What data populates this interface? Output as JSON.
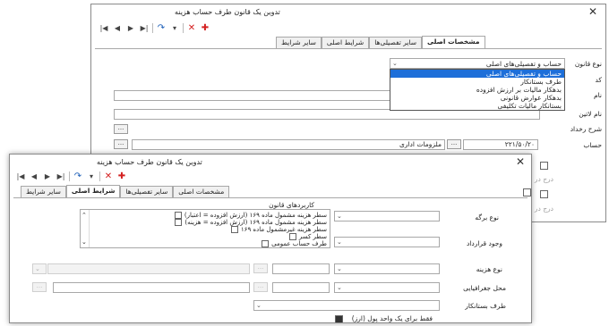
{
  "back_window": {
    "title": "تدوین یک قانون طرف حساب هزینه",
    "tabs": [
      "مشخصات اصلی",
      "سایر تفصیلی‌ها",
      "شرایط اصلی",
      "سایر شرایط"
    ],
    "labels": {
      "rule_type": "نوع قانون",
      "code_prefix": "کد",
      "name": "نام",
      "latin_name": "نام لاتین",
      "description": "شرح رخداد",
      "account": "حساب",
      "level_1": "درج در",
      "level_2": "درج در"
    },
    "rule_type_value": "حساب و تفصیلی‌های اصلی",
    "rule_type_options": [
      "حساب و تفصیلی‌های اصلی",
      "طرف بستانکار",
      "بدهکار مالیات بر ارزش افزوده",
      "بدهکار عوارض قانونی",
      "بستانکار مالیات تکلیفی"
    ],
    "account_code": "۲۲۱/۵۰/۲۰",
    "account_name": "ملزومات اداری"
  },
  "front_window": {
    "title": "تدوین یک قانون طرف حساب هزینه",
    "tabs": [
      "مشخصات اصلی",
      "سایر تفصیلی‌ها",
      "شرایط اصلی",
      "سایر شرایط"
    ],
    "rule_usage_title": "کاربردهای قانون",
    "rule_usages": [
      "سطر هزینه مشمول ماده ۱۶۹ (ارزش افزوده = اعتبار)",
      "سطر هزینه مشمول ماده ۱۶۹ (ارزش افزوده = هزینه)",
      "سطر هزینه غیرمشمول ماده ۱۶۹",
      "سطر کسر",
      "طرف حساب عمومی"
    ],
    "labels": {
      "form_type": "نوع برگه",
      "contract_exists": "وجود قرارداد",
      "expense_type": "نوع هزینه",
      "geo_location": "محل جغرافیایی",
      "creditor_side": "طرف بستانکار",
      "single_currency": "فقط برای یک واحد پول (ارز)"
    },
    "dots_label": "..."
  }
}
